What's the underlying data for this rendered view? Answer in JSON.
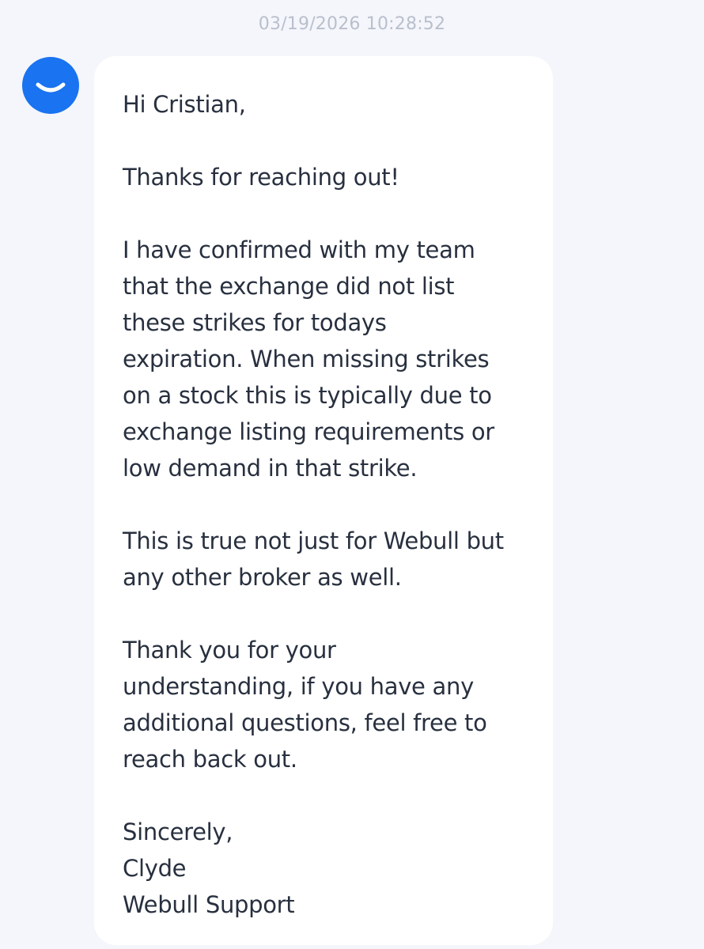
{
  "chat": {
    "timestamp": "03/19/2026 10:28:52",
    "sender_avatar_icon": "smile-logo-icon",
    "colors": {
      "avatar_bg": "#1a73f0",
      "bubble_bg": "#ffffff",
      "page_bg": "#f4f6fb",
      "text": "#28303f",
      "timestamp": "#b9bfcc"
    },
    "message": {
      "greeting": "Hi Cristian,",
      "thanks": "Thanks for reaching out!",
      "body_lines": [
        "I have confirmed with my team",
        "that the exchange did not list",
        "these strikes for todays",
        "expiration. When missing strikes",
        "on a stock this is typically due to",
        "exchange listing requirements or",
        "low demand in that strike."
      ],
      "broker_lines": [
        "This is true not just for Webull but",
        "any other broker as well."
      ],
      "closing_lines": [
        "Thank you for your",
        "understanding, if you have any",
        "additional questions, feel free to",
        "reach back out."
      ],
      "signature_lines": [
        "Sincerely,",
        "Clyde",
        "Webull Support"
      ]
    }
  }
}
